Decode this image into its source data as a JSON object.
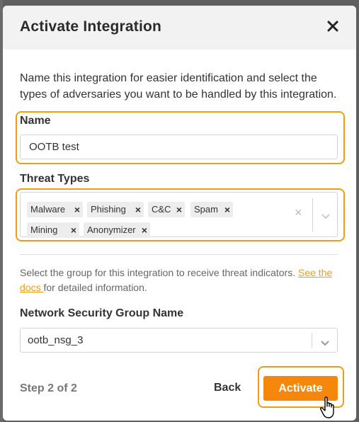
{
  "dialog": {
    "title": "Activate Integration",
    "close_icon": "close-icon",
    "intro": "Name this integration for easier identification and select the types of adversaries you want to be handled by this integration."
  },
  "name_field": {
    "label": "Name",
    "value": "OOTB test"
  },
  "threat_types": {
    "label": "Threat Types",
    "selected": [
      {
        "label": "Malware"
      },
      {
        "label": "Phishing"
      },
      {
        "label": "C&C"
      },
      {
        "label": "Spam"
      },
      {
        "label": "Mining"
      },
      {
        "label": "Anonymizer"
      }
    ],
    "remove_glyph": "×",
    "clear_glyph": "×"
  },
  "group_help": {
    "text_before": "Select the group for this integration to receive threat indicators. ",
    "link_text": "See the docs ",
    "text_after": "for detailed information."
  },
  "nsg": {
    "label": "Network Security Group Name",
    "selected_value": "ootb_nsg_3"
  },
  "footer": {
    "step_text": "Step 2 of 2",
    "back_label": "Back",
    "activate_label": "Activate"
  },
  "colors": {
    "accent": "#f5870a",
    "highlight_outline": "#f39c12",
    "link": "#f39c12"
  }
}
